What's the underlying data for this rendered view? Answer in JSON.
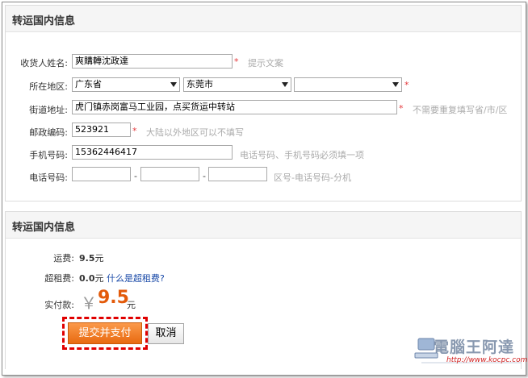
{
  "section1": {
    "title": "转运国内信息",
    "fields": {
      "name": {
        "label": "收货人姓名:",
        "value": "爽購轉沈政達",
        "hint": "提示文案"
      },
      "region": {
        "label": "所在地区:",
        "province": "广东省",
        "city": "东莞市",
        "district": ""
      },
      "street": {
        "label": "街道地址:",
        "value": "虎门镇赤岗富马工业园，点买货运中转站",
        "hint": "不需要重复填写省/市/区"
      },
      "zip": {
        "label": "邮政编码:",
        "value": "523921",
        "hint": "大陆以外地区可以不填写"
      },
      "mobile": {
        "label": "手机号码:",
        "value": "15362446417",
        "hint": "电话号码、手机号码必须填一项"
      },
      "phone": {
        "label": "电话号码:",
        "sep": "-",
        "hint": "区号-电话号码-分机"
      }
    },
    "required_mark": "*"
  },
  "section2": {
    "title": "转运国内信息",
    "freight": {
      "label": "运费:",
      "value": "9.5",
      "unit": "元"
    },
    "surcharge": {
      "label": "超租费:",
      "value": "0.0",
      "unit": "元",
      "link": "什么是超租费?"
    },
    "total": {
      "label": "实付款:",
      "currency": "￥",
      "value": "9.5",
      "unit": "元"
    },
    "submit_label": "提交并支付",
    "cancel_label": "取消"
  },
  "watermark": {
    "text": "電腦王阿達",
    "url": "http://www.kocpc.com.tw"
  },
  "colors": {
    "accent": "#e86a10",
    "required": "#e4393c",
    "link": "#1a4aa8",
    "highlight": "#e00000"
  }
}
